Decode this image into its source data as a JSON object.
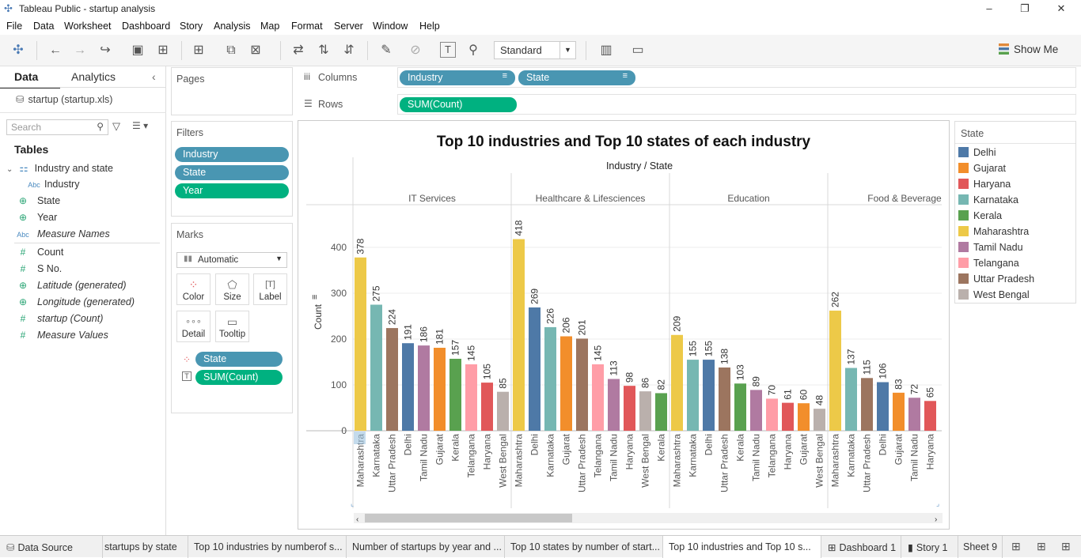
{
  "window": {
    "title": "Tableau Public - startup analysis",
    "minimize": "–",
    "restore": "❐",
    "close": "✕"
  },
  "menu": [
    "File",
    "Data",
    "Worksheet",
    "Dashboard",
    "Story",
    "Analysis",
    "Map",
    "Format",
    "Server",
    "Window",
    "Help"
  ],
  "toolbar": {
    "fit": "Standard",
    "show_me": "Show Me"
  },
  "data_pane": {
    "tab_data": "Data",
    "tab_analytics": "Analytics",
    "collapse": "‹",
    "datasource": "startup (startup.xls)",
    "search_placeholder": "Search",
    "tables_heading": "Tables",
    "hierarchy": "Industry and state",
    "fields": [
      {
        "icon": "Abc",
        "name": "Industry"
      },
      {
        "icon": "⊕",
        "name": "State"
      },
      {
        "icon": "⊕",
        "name": "Year"
      },
      {
        "icon": "Abc",
        "name": "Measure Names"
      },
      {
        "icon": "#",
        "name": "Count"
      },
      {
        "icon": "#",
        "name": "S No."
      },
      {
        "icon": "⊕",
        "name": "Latitude (generated)"
      },
      {
        "icon": "⊕",
        "name": "Longitude (generated)"
      },
      {
        "icon": "#",
        "name": "startup (Count)"
      },
      {
        "icon": "#",
        "name": "Measure Values"
      }
    ]
  },
  "cards": {
    "pages": "Pages",
    "filters": "Filters",
    "filter_pills": [
      "Industry",
      "State",
      "Year"
    ],
    "marks": "Marks",
    "mark_type": "Automatic",
    "mark_buttons": [
      "Color",
      "Size",
      "Label",
      "Detail",
      "Tooltip"
    ],
    "mark_pills": [
      "State",
      "SUM(Count)"
    ]
  },
  "shelves": {
    "columns_label": "Columns",
    "rows_label": "Rows",
    "columns_pills": [
      "Industry",
      "State"
    ],
    "rows_pills": [
      "SUM(Count)"
    ]
  },
  "legend": {
    "title": "State",
    "items": [
      {
        "name": "Delhi",
        "color": "#4e79a7"
      },
      {
        "name": "Gujarat",
        "color": "#f28e2b"
      },
      {
        "name": "Haryana",
        "color": "#e15759"
      },
      {
        "name": "Karnataka",
        "color": "#76b7b2"
      },
      {
        "name": "Kerala",
        "color": "#59a14f"
      },
      {
        "name": "Maharashtra",
        "color": "#edc948"
      },
      {
        "name": "Tamil Nadu",
        "color": "#b07aa1"
      },
      {
        "name": "Telangana",
        "color": "#ff9da7"
      },
      {
        "name": "Uttar Pradesh",
        "color": "#9c755f"
      },
      {
        "name": "West Bengal",
        "color": "#bab0ac"
      }
    ]
  },
  "chart_data": {
    "type": "bar",
    "title": "Top 10 industries and Top 10 states of each industry",
    "header": "Industry / State",
    "ylabel": "Count",
    "ylim": [
      0,
      450
    ],
    "yticks": [
      0,
      100,
      200,
      300,
      400
    ],
    "grid": true,
    "panels": [
      {
        "industry": "IT Services",
        "bars": [
          [
            "Maharashtra",
            378
          ],
          [
            "Karnataka",
            275
          ],
          [
            "Uttar Pradesh",
            224
          ],
          [
            "Delhi",
            191
          ],
          [
            "Tamil Nadu",
            186
          ],
          [
            "Gujarat",
            181
          ],
          [
            "Kerala",
            157
          ],
          [
            "Telangana",
            145
          ],
          [
            "Haryana",
            105
          ],
          [
            "West Bengal",
            85
          ]
        ]
      },
      {
        "industry": "Healthcare & Lifesciences",
        "bars": [
          [
            "Maharashtra",
            418
          ],
          [
            "Delhi",
            269
          ],
          [
            "Karnataka",
            226
          ],
          [
            "Gujarat",
            206
          ],
          [
            "Uttar Pradesh",
            201
          ],
          [
            "Telangana",
            145
          ],
          [
            "Tamil Nadu",
            113
          ],
          [
            "Haryana",
            98
          ],
          [
            "West Bengal",
            86
          ],
          [
            "Kerala",
            82
          ]
        ]
      },
      {
        "industry": "Education",
        "bars": [
          [
            "Maharashtra",
            209
          ],
          [
            "Karnataka",
            155
          ],
          [
            "Delhi",
            155
          ],
          [
            "Uttar Pradesh",
            138
          ],
          [
            "Kerala",
            103
          ],
          [
            "Tamil Nadu",
            89
          ],
          [
            "Telangana",
            70
          ],
          [
            "Haryana",
            61
          ],
          [
            "Gujarat",
            60
          ],
          [
            "West Bengal",
            48
          ]
        ]
      },
      {
        "industry": "Food & Beverages",
        "bars": [
          [
            "Maharashtra",
            262
          ],
          [
            "Karnataka",
            137
          ],
          [
            "Uttar Pradesh",
            115
          ],
          [
            "Delhi",
            106
          ],
          [
            "Gujarat",
            83
          ],
          [
            "Tamil Nadu",
            72
          ],
          [
            "Haryana",
            65
          ]
        ]
      }
    ]
  },
  "sheet_tabs": [
    "Data Source",
    "startups by state",
    "Top 10 industries by numberof s...",
    "Number of startups by year and ...",
    "Top 10 states by number of start...",
    "Top 10 industries and Top 10 s...",
    "Dashboard 1",
    "Story 1",
    "Sheet 9"
  ]
}
